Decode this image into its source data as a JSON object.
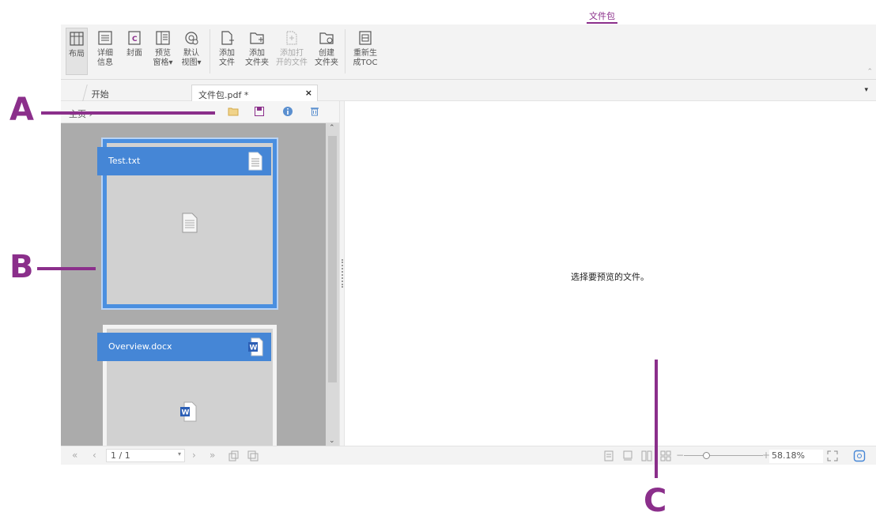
{
  "ribbon": {
    "active_tab": "文件包",
    "buttons": [
      {
        "id": "layout",
        "label1": "布局",
        "label2": "",
        "icon": "layout-icon"
      },
      {
        "id": "details",
        "label1": "详细",
        "label2": "信息",
        "icon": "details-list-icon"
      },
      {
        "id": "cover",
        "label1": "封面",
        "label2": "",
        "icon": "cover-icon"
      },
      {
        "id": "preview_pane",
        "label1": "预览",
        "label2": "窗格▾",
        "icon": "preview-pane-icon"
      },
      {
        "id": "default_view",
        "label1": "默认",
        "label2": "视图▾",
        "icon": "default-view-icon"
      },
      {
        "id": "add_file",
        "label1": "添加",
        "label2": "文件",
        "icon": "add-file-icon"
      },
      {
        "id": "add_folder",
        "label1": "添加",
        "label2": "文件夹",
        "icon": "add-folder-icon"
      },
      {
        "id": "add_open_files",
        "label1": "添加打",
        "label2": "开的文件",
        "icon": "add-open-files-icon"
      },
      {
        "id": "create_folder",
        "label1": "创建",
        "label2": "文件夹",
        "icon": "create-folder-icon"
      },
      {
        "id": "regenerate_toc",
        "label1": "重新生",
        "label2": "成TOC",
        "icon": "toc-icon"
      }
    ]
  },
  "tabs": [
    {
      "label": "开始"
    },
    {
      "label": "文件包.pdf *",
      "close": "×"
    }
  ],
  "tab_menu": "▾",
  "panel": {
    "breadcrumb": "主页 ›",
    "scroll_up": "⌃",
    "scroll_down": "⌄",
    "files": [
      {
        "name": "Test.txt",
        "type": "txt"
      },
      {
        "name": "Overview.docx",
        "type": "docx"
      }
    ]
  },
  "preview": {
    "message": "选择要预览的文件。"
  },
  "statusbar": {
    "first": "«",
    "prev": "‹",
    "page": "1 / 1",
    "dropdown": "▾",
    "next": "›",
    "last": "»",
    "zoom": "58.18%",
    "zoom_minus": "−",
    "zoom_plus": "+"
  },
  "callouts": {
    "a": "A",
    "b": "B",
    "c": "C"
  },
  "colors": {
    "accent": "#8b2f8b",
    "card_header": "#4586d6",
    "panel_bg": "#ababab"
  }
}
